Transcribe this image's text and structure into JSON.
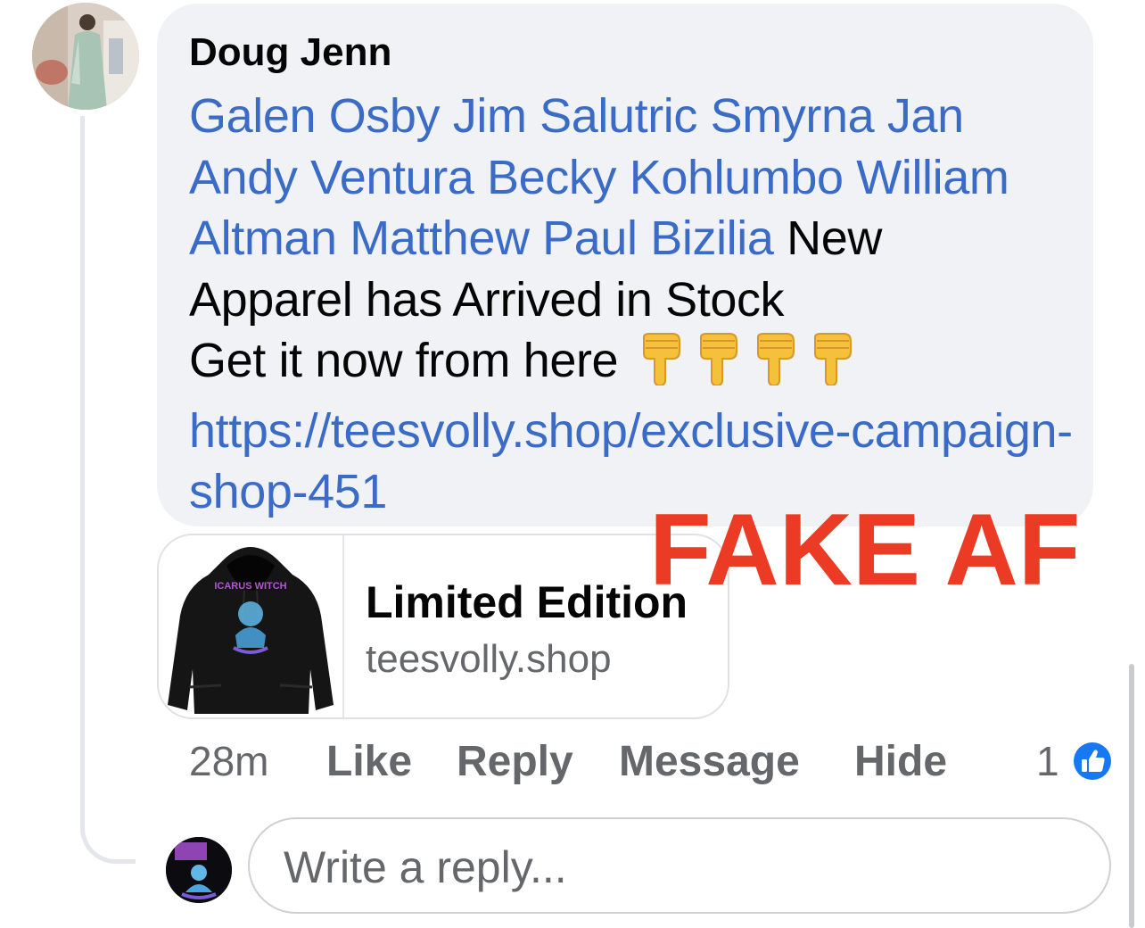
{
  "comment": {
    "author": "Doug Jenn",
    "tagged": [
      "Galen Osby",
      "Jim Salutric",
      "Smyrna Jan",
      "Andy Ventura",
      "Becky Kohlumbo",
      "William Altman",
      "Matthew Paul Bizilia"
    ],
    "text_line1": "New",
    "text_line2": "Apparel has Arrived in Stock",
    "text_line3": "Get it now from here",
    "emoji": [
      "pointing-down-emoji",
      "pointing-down-emoji",
      "pointing-down-emoji",
      "pointing-down-emoji"
    ],
    "link": "https://teesvolly.shop/exclusive-campaign-shop-451"
  },
  "overlay_label": "FAKE AF",
  "link_preview": {
    "title": "Limited Edition",
    "domain": "teesvolly.shop",
    "thumbnail_icon": "hoodie-thumbnail",
    "thumbnail_text": "ICARUS WITCH"
  },
  "actions": {
    "timestamp": "28m",
    "like": "Like",
    "reply": "Reply",
    "message": "Message",
    "hide": "Hide",
    "reaction_count": "1",
    "reaction_icon": "thumbs-up-icon"
  },
  "reply_input": {
    "placeholder": "Write a reply...",
    "value": ""
  },
  "colors": {
    "link": "#3a6bc6",
    "overlay": "#ec3b24",
    "bubble": "#f0f2f5",
    "like_blue": "#1877f2"
  }
}
